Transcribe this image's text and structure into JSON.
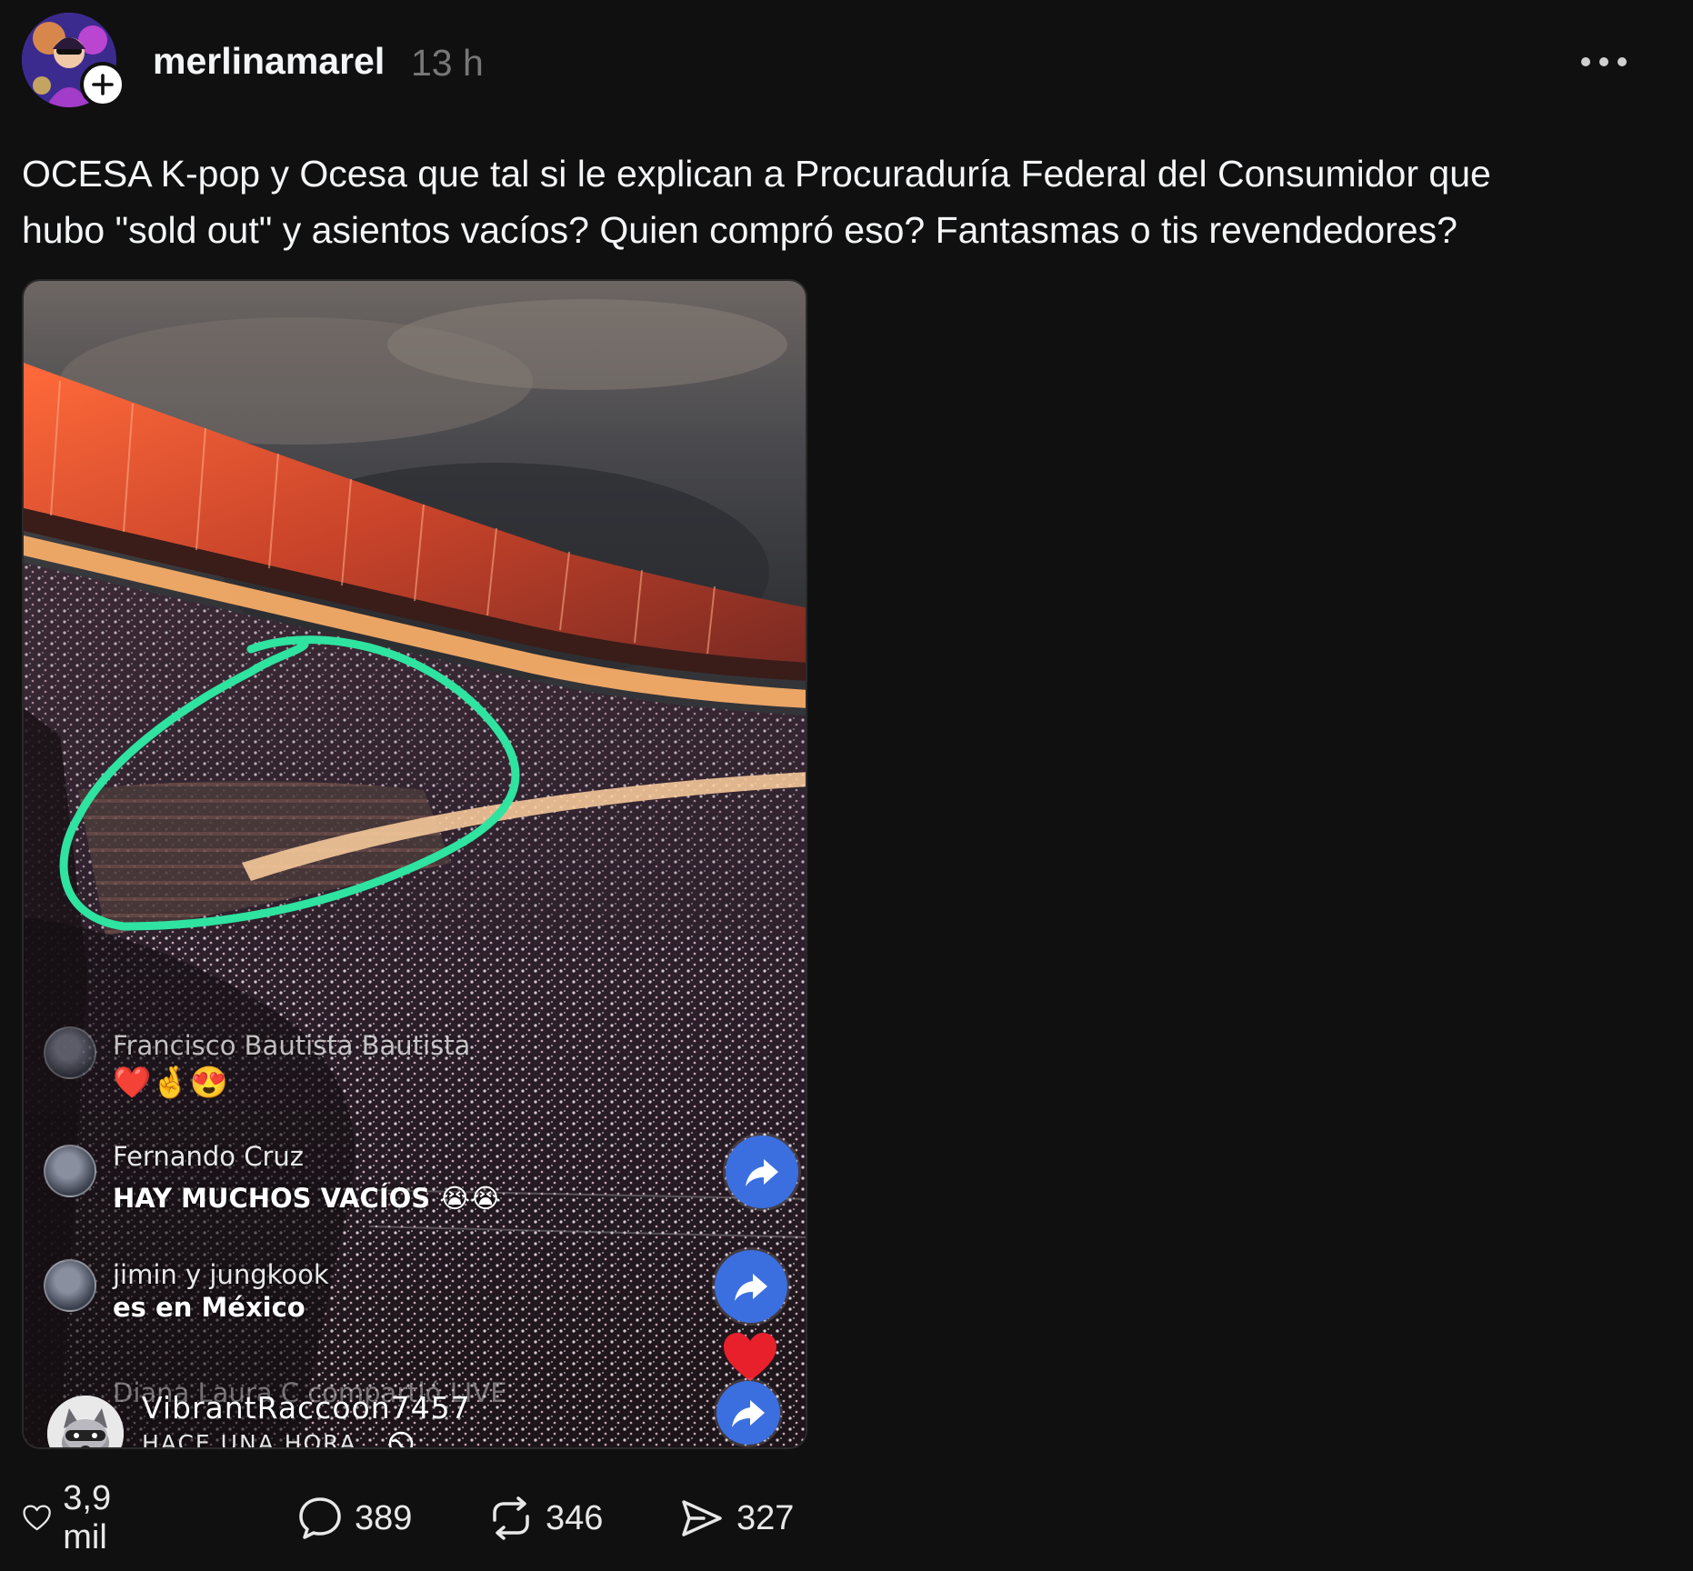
{
  "post": {
    "username": "merlinamarel",
    "time": "13 h",
    "text": "OCESA K-pop y Ocesa que tal si le explican a Procuraduría Federal del Consumidor que\nhubo \"sold out\" y asientos vacíos? Quien compró eso? Fantasmas o tis revendedores?",
    "icons": {
      "follow": "plus-icon",
      "more": "more-options-icon"
    }
  },
  "media": {
    "overlay": {
      "comment1_name": "Francisco Bautista Bautista",
      "emojis": "❤️🤞😍",
      "comment2_name": "Fernando Cruz",
      "comment2_text": "HAY MUCHOS VACÍOS 😭😭",
      "comment3_name": "jimin y jungkook",
      "comment3_text": "es en México",
      "comment4_text": "Diana Laura C compartió LIVE",
      "viewer_name": "VibrantRaccoon7457",
      "viewer_time": "HACE UNA HORA"
    },
    "colors": {
      "annotation": "#2fe3a0",
      "share_bubble": "#3b6fe0",
      "heart": "#e8202c"
    }
  },
  "actions": {
    "likes": "3,9 mil",
    "comments": "389",
    "reposts": "346",
    "shares": "327"
  }
}
